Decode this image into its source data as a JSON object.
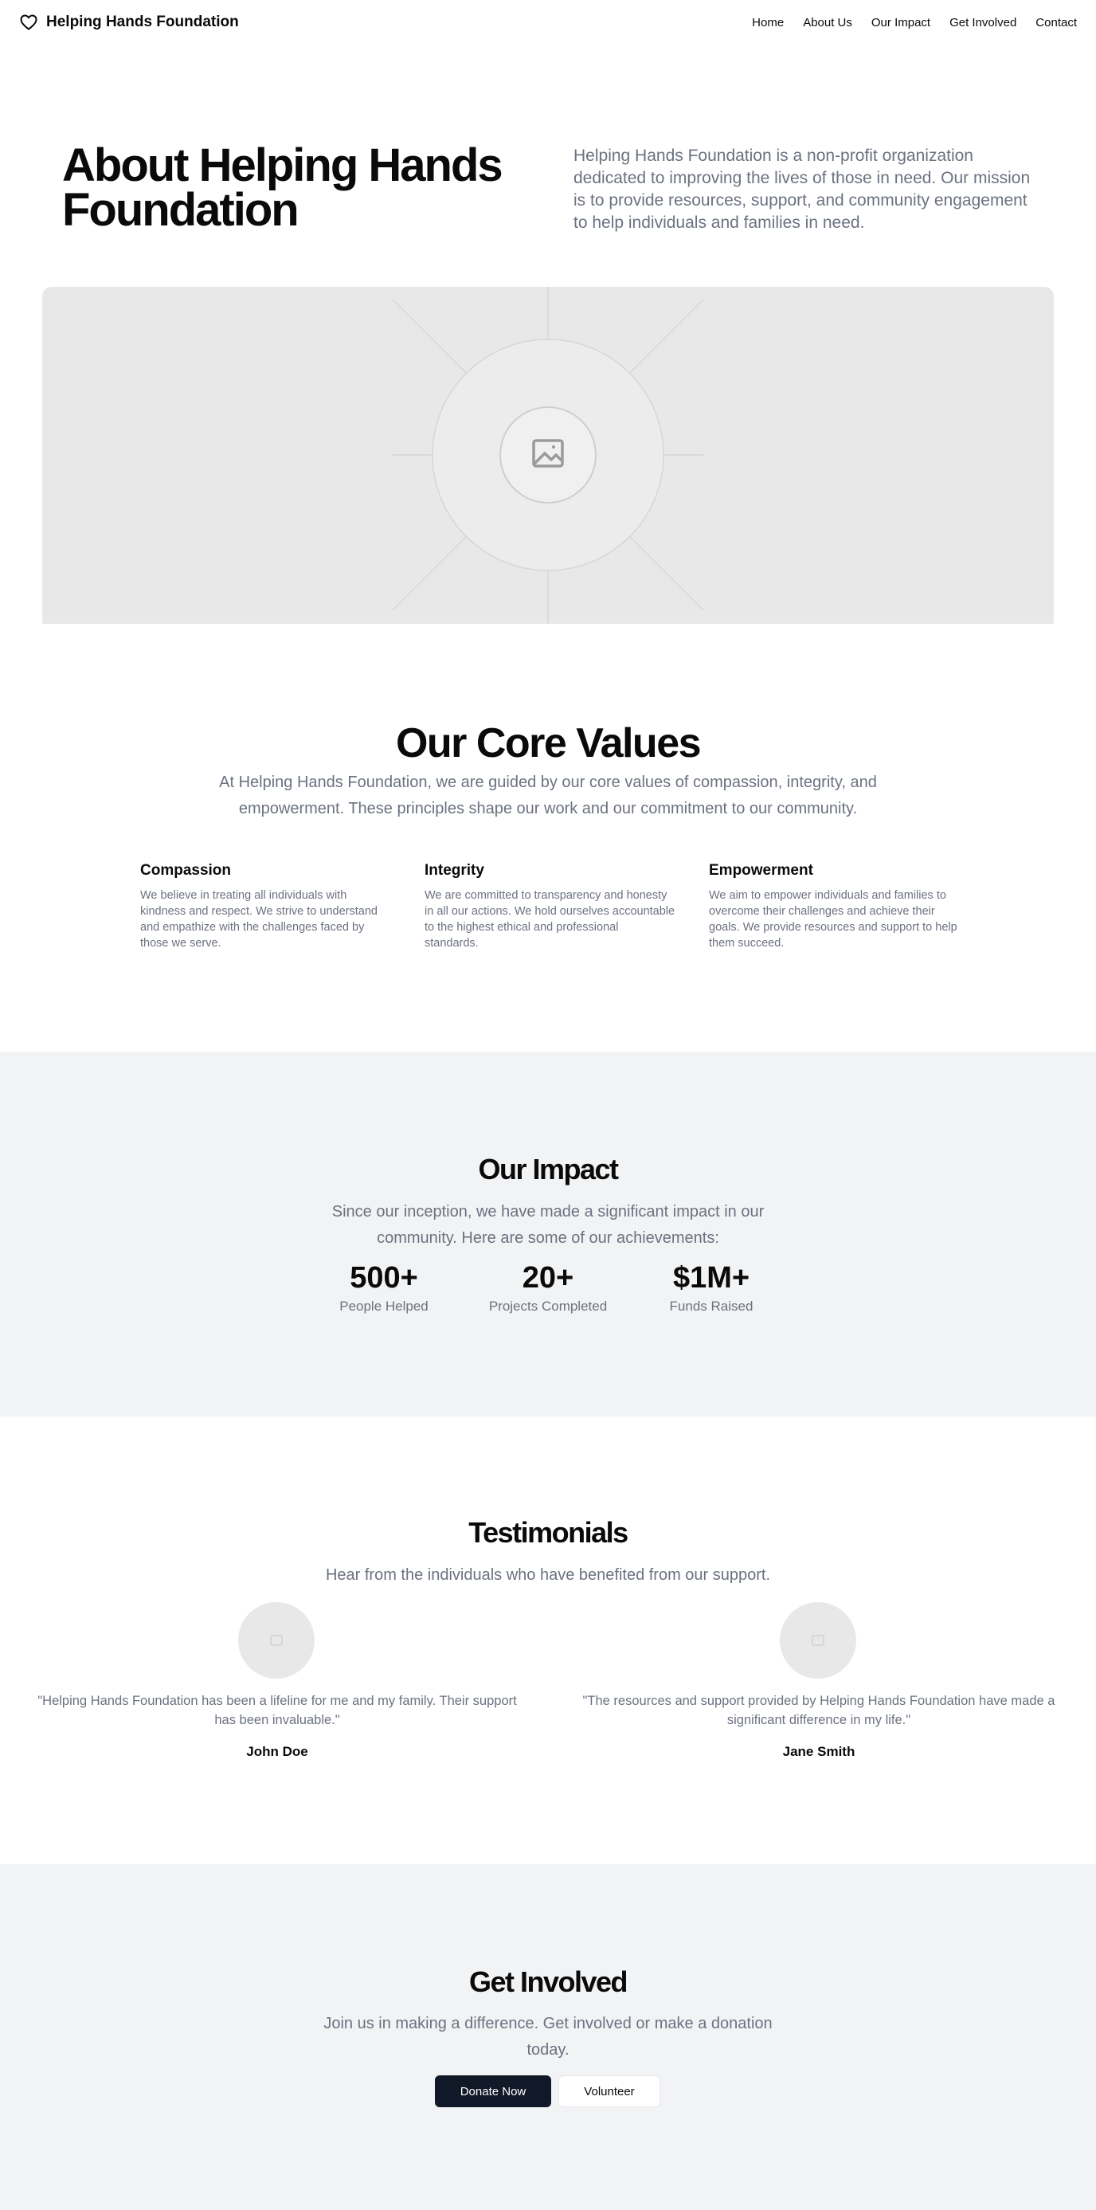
{
  "header": {
    "brand": "Helping Hands Foundation",
    "nav": [
      "Home",
      "About Us",
      "Our Impact",
      "Get Involved",
      "Contact"
    ]
  },
  "hero": {
    "title": "About Helping Hands Foundation",
    "description": "Helping Hands Foundation is a non-profit organization dedicated to improving the lives of those in need. Our mission is to provide resources, support, and community engagement to help individuals and families in need."
  },
  "values": {
    "title": "Our Core Values",
    "subtitle_line1": "At Helping Hands Foundation, we are guided by our core values of compassion, integrity, and",
    "subtitle_line2": "empowerment. These principles shape our work and our commitment to our community.",
    "items": [
      {
        "title": "Compassion",
        "text": "We believe in treating all individuals with kindness and respect. We strive to understand and empathize with the challenges faced by those we serve."
      },
      {
        "title": "Integrity",
        "text": "We are committed to transparency and honesty in all our actions. We hold ourselves accountable to the highest ethical and professional standards."
      },
      {
        "title": "Empowerment",
        "text": "We aim to empower individuals and families to overcome their challenges and achieve their goals. We provide resources and support to help them succeed."
      }
    ]
  },
  "impact": {
    "title": "Our Impact",
    "subtitle_line1": "Since our inception, we have made a significant impact in our",
    "subtitle_line2": "community. Here are some of our achievements:",
    "stats": [
      {
        "value": "500+",
        "label": "People Helped"
      },
      {
        "value": "20+",
        "label": "Projects Completed"
      },
      {
        "value": "$1M+",
        "label": "Funds Raised"
      }
    ]
  },
  "testimonials": {
    "title": "Testimonials",
    "subtitle": "Hear from the individuals who have benefited from our support.",
    "items": [
      {
        "quote_line1": "\"Helping Hands Foundation has been a lifeline for me and my family. Their support",
        "quote_line2": "has been invaluable.\"",
        "author": "John Doe"
      },
      {
        "quote_line1": "\"The resources and support provided by Helping Hands Foundation have made a",
        "quote_line2": "significant difference in my life.\"",
        "author": "Jane Smith"
      }
    ]
  },
  "involved": {
    "title": "Get Involved",
    "subtitle_line1": "Join us in making a difference. Get involved or make a donation",
    "subtitle_line2": "today.",
    "donate_label": "Donate Now",
    "volunteer_label": "Volunteer"
  },
  "colors": {
    "accent": "#111827",
    "muted_text": "#6b7280",
    "band_bg": "#f2f3f5",
    "placeholder_bg": "#e8e8e8"
  },
  "icons": {
    "brand": "heart-icon",
    "hero": "image-placeholder-icon",
    "avatar": "avatar-placeholder-icon"
  }
}
